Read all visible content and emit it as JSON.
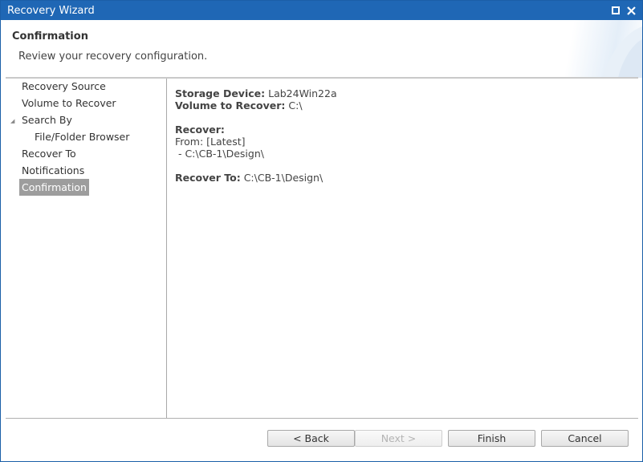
{
  "window": {
    "title": "Recovery Wizard"
  },
  "header": {
    "title": "Confirmation",
    "subtitle": "Review your recovery configuration."
  },
  "nav": {
    "items": [
      {
        "label": "Recovery Source"
      },
      {
        "label": "Volume to Recover"
      },
      {
        "label": "Search By"
      },
      {
        "label": "File/Folder Browser"
      },
      {
        "label": "Recover To"
      },
      {
        "label": "Notifications"
      },
      {
        "label": "Confirmation"
      }
    ],
    "selected": "Confirmation"
  },
  "summary": {
    "storage_device_label": "Storage Device:",
    "storage_device_value": "Lab24Win22a",
    "volume_label": "Volume to Recover:",
    "volume_value": "C:\\",
    "recover_label": "Recover:",
    "from_line": "From: [Latest]",
    "path_line": " - C:\\CB-1\\Design\\",
    "recover_to_label": "Recover To:",
    "recover_to_value": "C:\\CB-1\\Design\\"
  },
  "buttons": {
    "back": "< Back",
    "next": "Next >",
    "finish": "Finish",
    "cancel": "Cancel"
  },
  "colors": {
    "titlebar": "#1f67b5",
    "selected_nav": "#9d9d9d"
  }
}
